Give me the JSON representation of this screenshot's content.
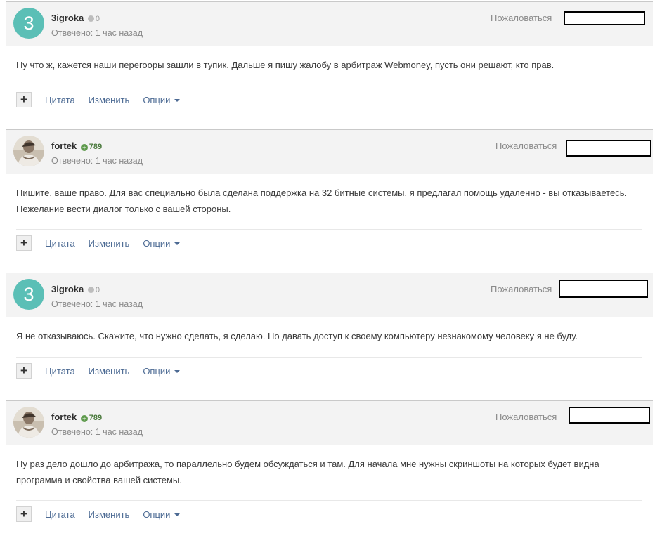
{
  "posts": [
    {
      "author": "3igroka",
      "avatar_letter": "3",
      "rep": "0",
      "rep_type": "neutral",
      "answered": "Отвечено: 1 час назад",
      "report": "Пожаловаться",
      "text": "Ну что ж, кажется наши перегооры зашли в тупик. Дальше я пишу жалобу в арбитраж Webmoney, пусть они решают, кто прав."
    },
    {
      "author": "fortek",
      "avatar_letter": "",
      "rep": "789",
      "rep_type": "positive",
      "answered": "Отвечено: 1 час назад",
      "report": "Пожаловаться",
      "text": "Пишите, ваше право. Для вас специально была сделана поддержка на 32 битные системы, я предлагал помощь удаленно - вы отказываетесь. Нежелание вести диалог только с вашей стороны."
    },
    {
      "author": "3igroka",
      "avatar_letter": "3",
      "rep": "0",
      "rep_type": "neutral",
      "answered": "Отвечено: 1 час назад",
      "report": "Пожаловаться",
      "text": "Я не отказываюсь. Скажите, что нужно сделать, я сделаю. Но давать доступ к своему компьютеру незнакомому человеку я не буду."
    },
    {
      "author": "fortek",
      "avatar_letter": "",
      "rep": "789",
      "rep_type": "positive",
      "answered": "Отвечено: 1 час назад",
      "report": "Пожаловаться",
      "text": "Ну раз дело дошло до арбитража, то параллельно будем обсуждаться и там. Для начала мне нужны скриншоты на которых будет видна программа и свойства вашей системы."
    }
  ],
  "controls": {
    "plus": "+",
    "quote": "Цитата",
    "edit": "Изменить",
    "options": "Опции"
  },
  "colors": {
    "avatar_teal": "#5bbfb6",
    "link": "#4d6b94",
    "rep_positive": "#5e9a4c"
  }
}
